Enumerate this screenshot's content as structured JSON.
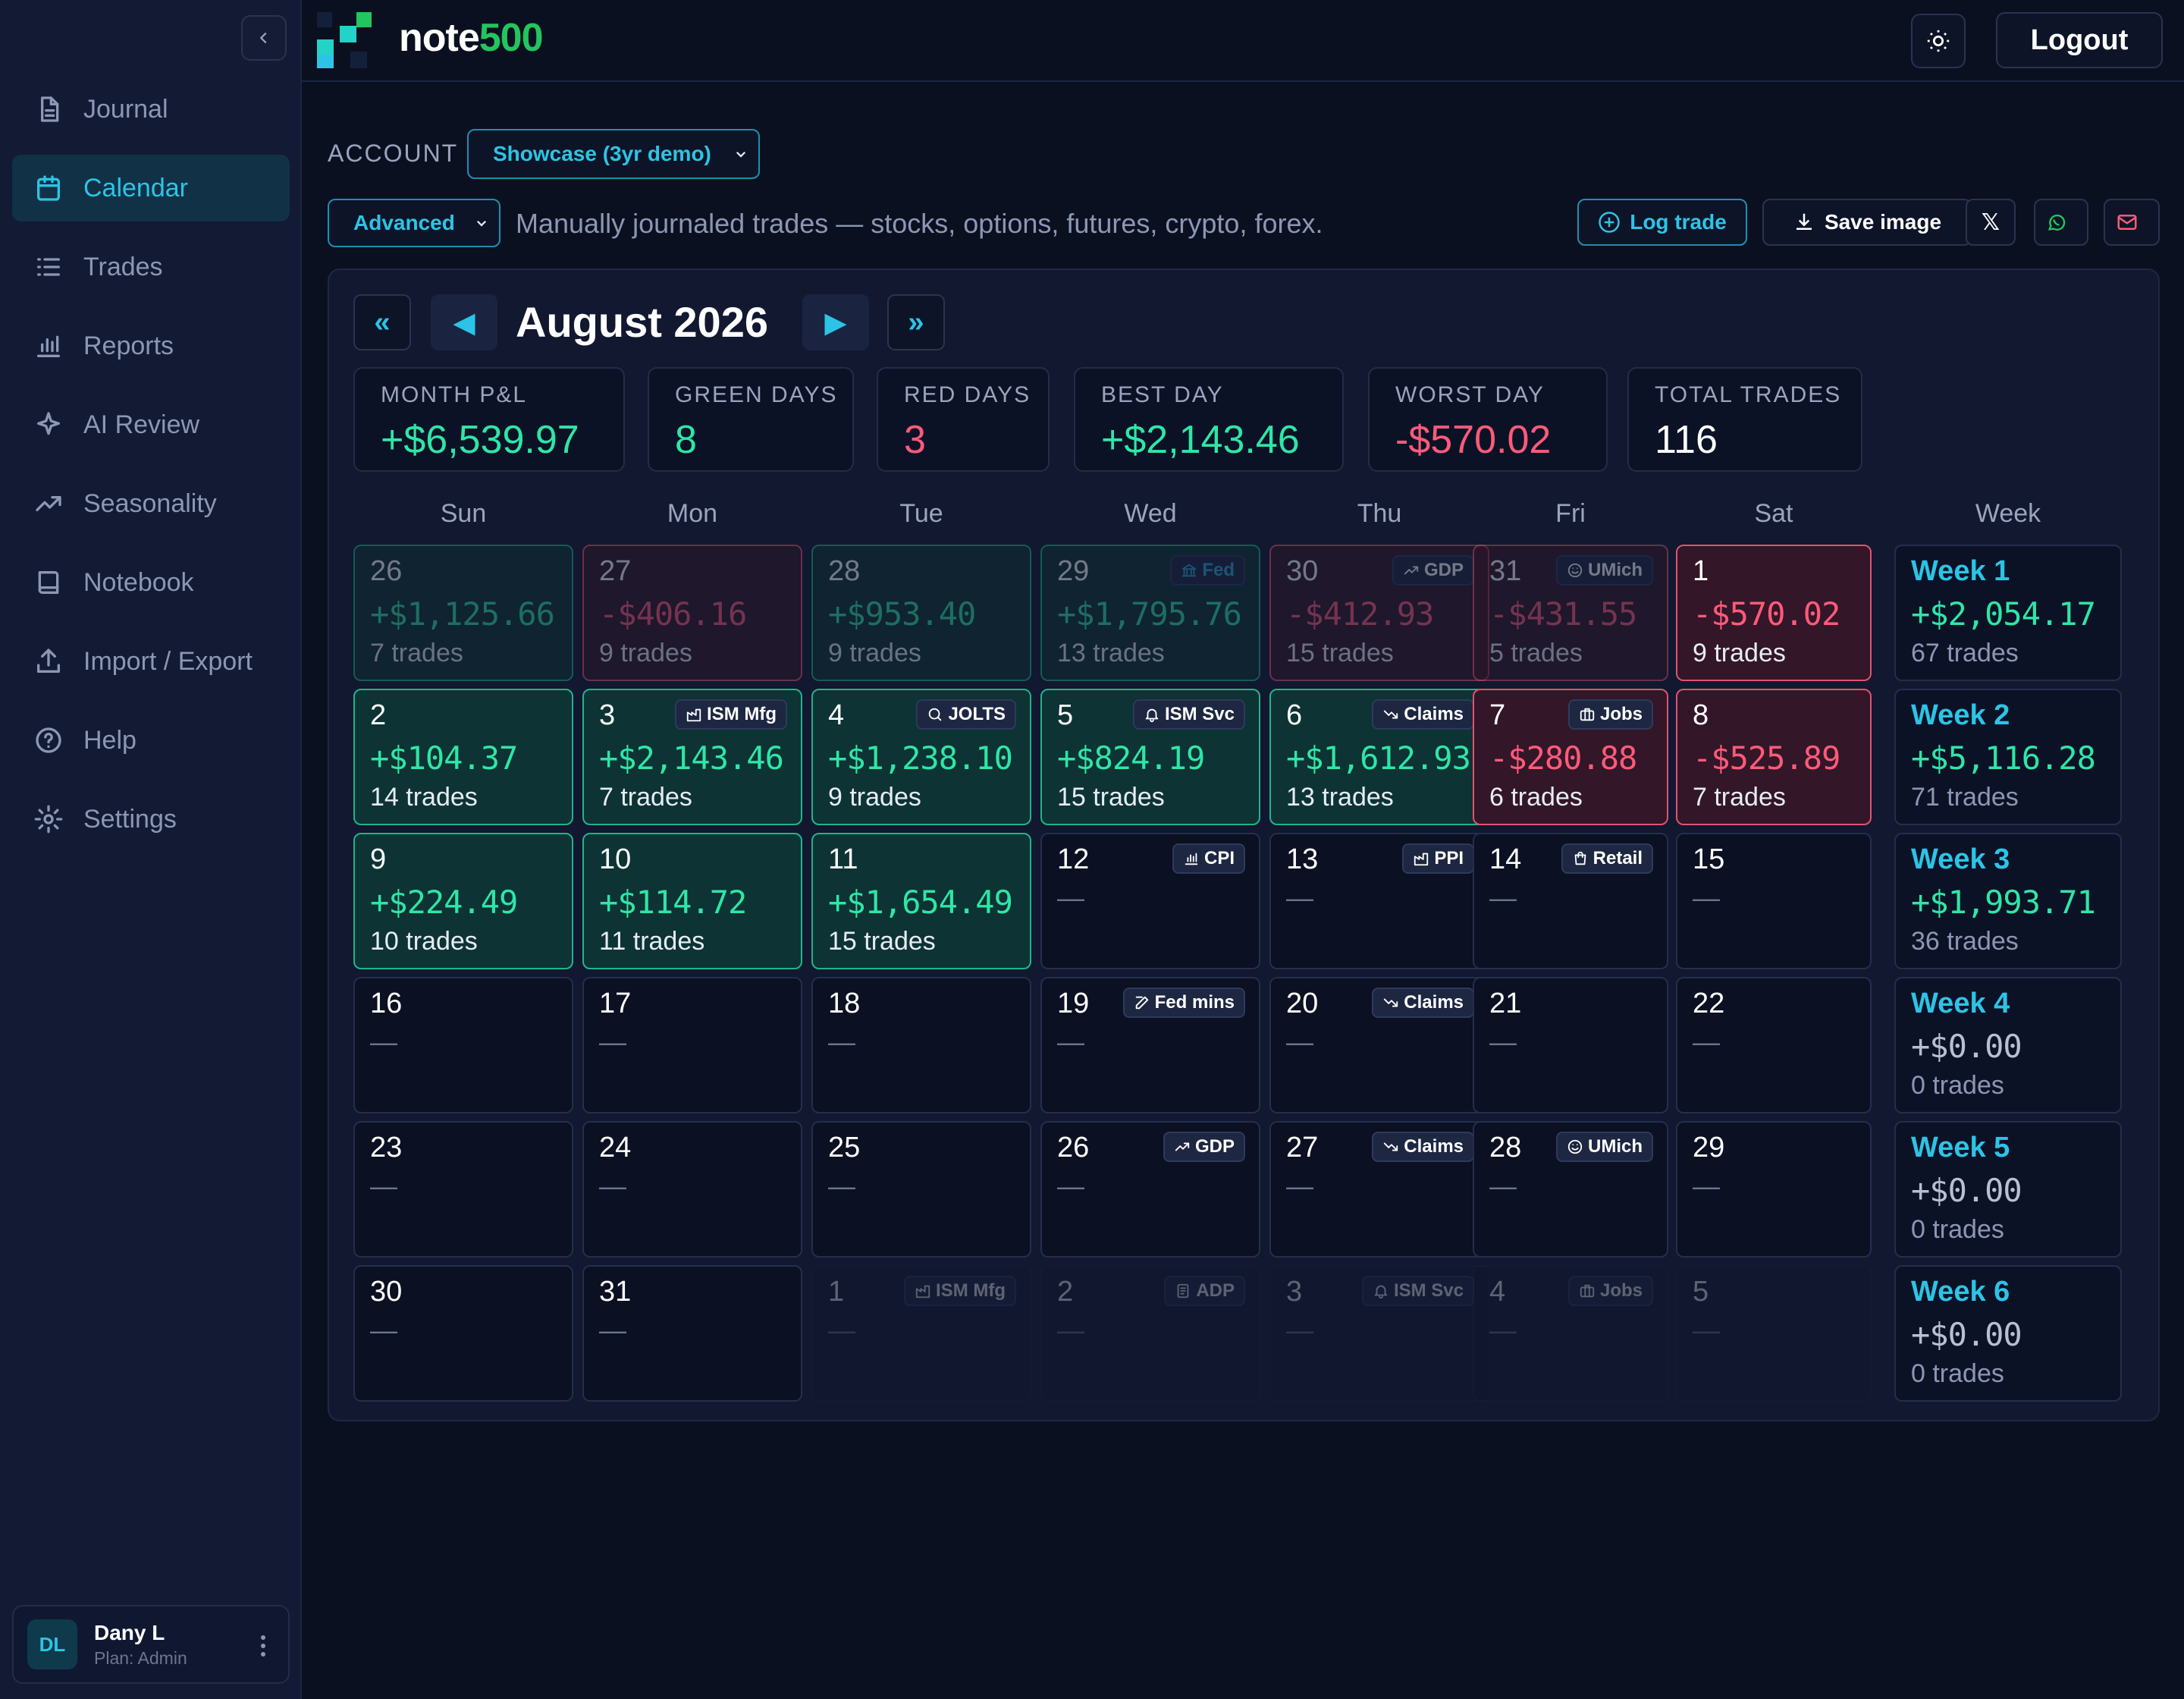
{
  "brand": {
    "part1": "note",
    "part2": "500"
  },
  "topbar": {
    "logout_label": "Logout"
  },
  "sidebar": {
    "items": [
      {
        "label": "Journal",
        "icon": "file-icon"
      },
      {
        "label": "Calendar",
        "icon": "calendar-icon",
        "active": true
      },
      {
        "label": "Trades",
        "icon": "list-icon"
      },
      {
        "label": "Reports",
        "icon": "bar-chart-icon"
      },
      {
        "label": "AI Review",
        "icon": "sparkle-icon"
      },
      {
        "label": "Seasonality",
        "icon": "trend-icon"
      },
      {
        "label": "Notebook",
        "icon": "book-icon"
      },
      {
        "label": "Import / Export",
        "icon": "upload-icon"
      },
      {
        "label": "Help",
        "icon": "help-icon"
      },
      {
        "label": "Settings",
        "icon": "gear-icon"
      }
    ],
    "user": {
      "initials": "DL",
      "name": "Dany L",
      "plan": "Plan: Admin"
    }
  },
  "controls": {
    "account_label": "ACCOUNT",
    "account_value": "Showcase (3yr demo)",
    "mode_value": "Advanced",
    "description": "Manually journaled trades — stocks, options, futures, crypto, forex.",
    "log_trade_label": "Log trade",
    "save_image_label": "Save image",
    "x_label": "𝕏"
  },
  "calendar": {
    "nav": {
      "first": "«",
      "prev": "◀",
      "next": "▶",
      "last": "»"
    },
    "title": "August 2026",
    "stats": [
      {
        "label": "MONTH P&L",
        "value": "+$6,539.97",
        "tone": "green"
      },
      {
        "label": "GREEN DAYS",
        "value": "8",
        "tone": "green"
      },
      {
        "label": "RED DAYS",
        "value": "3",
        "tone": "red"
      },
      {
        "label": "BEST DAY",
        "value": "+$2,143.46",
        "tone": "green"
      },
      {
        "label": "WORST DAY",
        "value": "-$570.02",
        "tone": "red"
      },
      {
        "label": "TOTAL TRADES",
        "value": "116",
        "tone": "white"
      }
    ],
    "weekdays": [
      "Sun",
      "Mon",
      "Tue",
      "Wed",
      "Thu",
      "Fri",
      "Sat",
      "Week"
    ],
    "weeks": [
      {
        "days": [
          {
            "day": "26",
            "pnl": "+$1,125.66",
            "trades": "7 trades",
            "status": "win",
            "muted": true
          },
          {
            "day": "27",
            "pnl": "-$406.16",
            "trades": "9 trades",
            "status": "loss",
            "muted": true
          },
          {
            "day": "28",
            "pnl": "+$953.40",
            "trades": "9 trades",
            "status": "win",
            "muted": true
          },
          {
            "day": "29",
            "pnl": "+$1,795.76",
            "trades": "13 trades",
            "status": "win",
            "muted": true,
            "event": "Fed",
            "event_icon": "bank-icon",
            "event_blue": true
          },
          {
            "day": "30",
            "pnl": "-$412.93",
            "trades": "15 trades",
            "status": "loss",
            "muted": true,
            "event": "GDP",
            "event_icon": "trend-up-icon"
          },
          {
            "day": "31",
            "pnl": "-$431.55",
            "trades": "5 trades",
            "status": "loss",
            "muted": true,
            "event": "UMich",
            "event_icon": "smile-icon"
          },
          {
            "day": "1",
            "pnl": "-$570.02",
            "trades": "9 trades",
            "status": "loss"
          }
        ],
        "week": {
          "label": "Week 1",
          "pnl": "+$2,054.17",
          "trades": "67 trades",
          "tone": "green"
        }
      },
      {
        "days": [
          {
            "day": "2",
            "pnl": "+$104.37",
            "trades": "14 trades",
            "status": "win"
          },
          {
            "day": "3",
            "pnl": "+$2,143.46",
            "trades": "7 trades",
            "status": "win",
            "event": "ISM Mfg",
            "event_icon": "factory-icon"
          },
          {
            "day": "4",
            "pnl": "+$1,238.10",
            "trades": "9 trades",
            "status": "win",
            "event": "JOLTS",
            "event_icon": "search-icon"
          },
          {
            "day": "5",
            "pnl": "+$824.19",
            "trades": "15 trades",
            "status": "win",
            "event": "ISM Svc",
            "event_icon": "bell-icon"
          },
          {
            "day": "6",
            "pnl": "+$1,612.93",
            "trades": "13 trades",
            "status": "win",
            "event": "Claims",
            "event_icon": "trend-down-icon"
          },
          {
            "day": "7",
            "pnl": "-$280.88",
            "trades": "6 trades",
            "status": "loss",
            "event": "Jobs",
            "event_icon": "briefcase-icon"
          },
          {
            "day": "8",
            "pnl": "-$525.89",
            "trades": "7 trades",
            "status": "loss"
          }
        ],
        "week": {
          "label": "Week 2",
          "pnl": "+$5,116.28",
          "trades": "71 trades",
          "tone": "green"
        }
      },
      {
        "days": [
          {
            "day": "9",
            "pnl": "+$224.49",
            "trades": "10 trades",
            "status": "win"
          },
          {
            "day": "10",
            "pnl": "+$114.72",
            "trades": "11 trades",
            "status": "win"
          },
          {
            "day": "11",
            "pnl": "+$1,654.49",
            "trades": "15 trades",
            "status": "win"
          },
          {
            "day": "12",
            "empty": "—",
            "event": "CPI",
            "event_icon": "bar-chart-icon"
          },
          {
            "day": "13",
            "empty": "—",
            "event": "PPI",
            "event_icon": "factory-icon"
          },
          {
            "day": "14",
            "empty": "—",
            "event": "Retail",
            "event_icon": "bag-icon"
          },
          {
            "day": "15",
            "empty": "—"
          }
        ],
        "week": {
          "label": "Week 3",
          "pnl": "+$1,993.71",
          "trades": "36 trades",
          "tone": "green"
        }
      },
      {
        "days": [
          {
            "day": "16",
            "empty": "—"
          },
          {
            "day": "17",
            "empty": "—"
          },
          {
            "day": "18",
            "empty": "—"
          },
          {
            "day": "19",
            "empty": "—",
            "event": "Fed mins",
            "event_icon": "edit-icon"
          },
          {
            "day": "20",
            "empty": "—",
            "event": "Claims",
            "event_icon": "trend-down-icon"
          },
          {
            "day": "21",
            "empty": "—"
          },
          {
            "day": "22",
            "empty": "—"
          }
        ],
        "week": {
          "label": "Week 4",
          "pnl": "+$0.00",
          "trades": "0 trades",
          "tone": "zero"
        }
      },
      {
        "days": [
          {
            "day": "23",
            "empty": "—"
          },
          {
            "day": "24",
            "empty": "—"
          },
          {
            "day": "25",
            "empty": "—"
          },
          {
            "day": "26",
            "empty": "—",
            "event": "GDP",
            "event_icon": "trend-up-icon"
          },
          {
            "day": "27",
            "empty": "—",
            "event": "Claims",
            "event_icon": "trend-down-icon"
          },
          {
            "day": "28",
            "empty": "—",
            "event": "UMich",
            "event_icon": "smile-icon"
          },
          {
            "day": "29",
            "empty": "—"
          }
        ],
        "week": {
          "label": "Week 5",
          "pnl": "+$0.00",
          "trades": "0 trades",
          "tone": "zero"
        }
      },
      {
        "days": [
          {
            "day": "30",
            "empty": "—"
          },
          {
            "day": "31",
            "empty": "—"
          },
          {
            "day": "1",
            "empty": "—",
            "out": true,
            "event": "ISM Mfg",
            "event_icon": "factory-icon"
          },
          {
            "day": "2",
            "empty": "—",
            "out": true,
            "event": "ADP",
            "event_icon": "doc-icon"
          },
          {
            "day": "3",
            "empty": "—",
            "out": true,
            "event": "ISM Svc",
            "event_icon": "bell-icon"
          },
          {
            "day": "4",
            "empty": "—",
            "out": true,
            "event": "Jobs",
            "event_icon": "briefcase-icon"
          },
          {
            "day": "5",
            "empty": "—",
            "out": true
          }
        ],
        "week": {
          "label": "Week 6",
          "pnl": "+$0.00",
          "trades": "0 trades",
          "tone": "zero"
        }
      }
    ]
  },
  "colors": {
    "accent": "#2cc4e6",
    "brand_green": "#22c55e",
    "win": "#2ee6a6",
    "loss": "#ff5a7a"
  }
}
